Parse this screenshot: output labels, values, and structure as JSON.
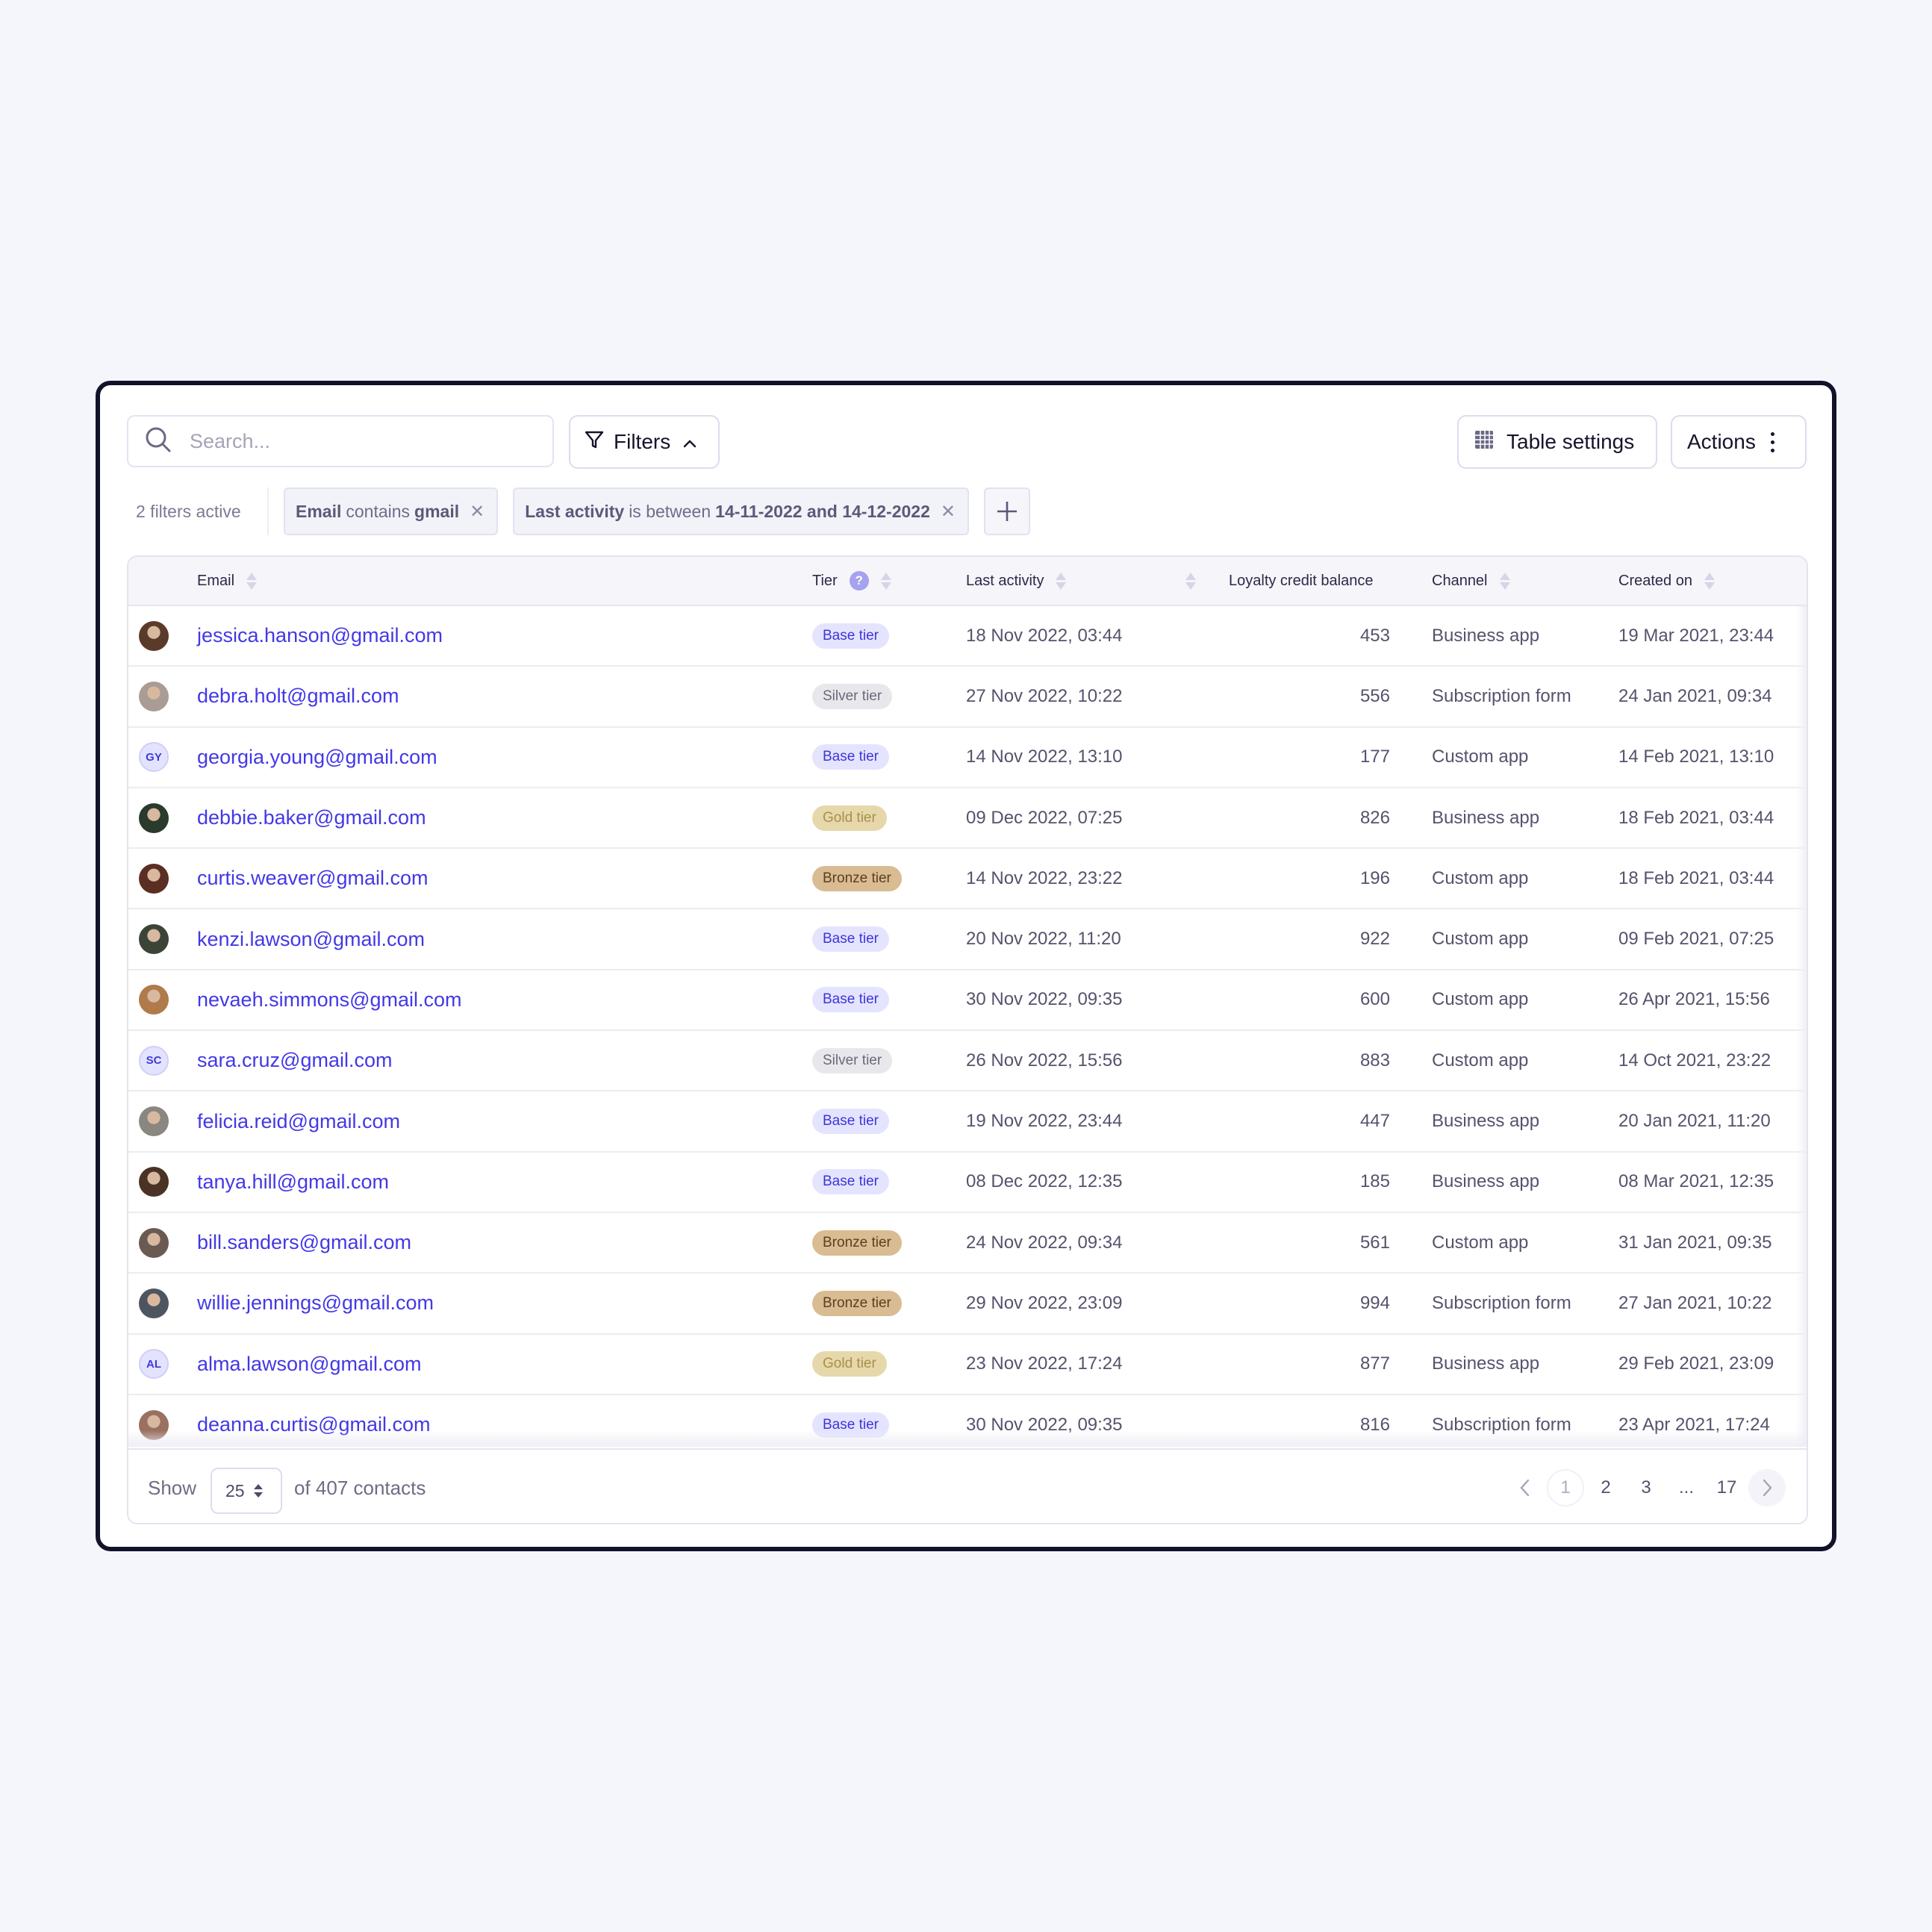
{
  "toolbar": {
    "search_placeholder": "Search...",
    "search_value": "",
    "filters_label": "Filters",
    "table_settings_label": "Table settings",
    "actions_label": "Actions"
  },
  "filters": {
    "active_count_label": "2 filters active",
    "chips": [
      {
        "field": "Email",
        "op": "contains",
        "value": "gmail"
      },
      {
        "field": "Last activity",
        "op": "is between",
        "value": "14-11-2022 and 14-12-2022"
      }
    ]
  },
  "table": {
    "columns": {
      "email": "Email",
      "tier": "Tier",
      "last_activity": "Last activity",
      "loyalty": "Loyalty credit balance",
      "channel": "Channel",
      "created_on": "Created on"
    },
    "tier_help_icon": "?",
    "rows": [
      {
        "avatar": {
          "type": "photo",
          "color": "#5a3b2a"
        },
        "email": "jessica.hanson@gmail.com",
        "tier": "Base tier",
        "tier_kind": "base",
        "last_activity": "18 Nov 2022, 03:44",
        "loyalty": "453",
        "channel": "Business app",
        "created_on": "19 Mar 2021, 23:44"
      },
      {
        "avatar": {
          "type": "photo",
          "color": "#a89c94"
        },
        "email": "debra.holt@gmail.com",
        "tier": "Silver tier",
        "tier_kind": "silver",
        "last_activity": "27 Nov 2022, 10:22",
        "loyalty": "556",
        "channel": "Subscription form",
        "created_on": "24 Jan 2021, 09:34"
      },
      {
        "avatar": {
          "type": "initials",
          "initials": "GY"
        },
        "email": "georgia.young@gmail.com",
        "tier": "Base tier",
        "tier_kind": "base",
        "last_activity": "14 Nov 2022, 13:10",
        "loyalty": "177",
        "channel": "Custom app",
        "created_on": "14 Feb 2021, 13:10"
      },
      {
        "avatar": {
          "type": "photo",
          "color": "#2a3a2c"
        },
        "email": "debbie.baker@gmail.com",
        "tier": "Gold tier",
        "tier_kind": "gold",
        "last_activity": "09 Dec 2022, 07:25",
        "loyalty": "826",
        "channel": "Business app",
        "created_on": "18 Feb 2021, 03:44"
      },
      {
        "avatar": {
          "type": "photo",
          "color": "#5a2e22"
        },
        "email": "curtis.weaver@gmail.com",
        "tier": "Bronze tier",
        "tier_kind": "bronze",
        "last_activity": "14 Nov 2022, 23:22",
        "loyalty": "196",
        "channel": "Custom app",
        "created_on": "18 Feb 2021, 03:44"
      },
      {
        "avatar": {
          "type": "photo",
          "color": "#3c4438"
        },
        "email": "kenzi.lawson@gmail.com",
        "tier": "Base tier",
        "tier_kind": "base",
        "last_activity": "20 Nov 2022, 11:20",
        "loyalty": "922",
        "channel": "Custom app",
        "created_on": "09 Feb 2021, 07:25"
      },
      {
        "avatar": {
          "type": "photo",
          "color": "#b07a4a"
        },
        "email": "nevaeh.simmons@gmail.com",
        "tier": "Base tier",
        "tier_kind": "base",
        "last_activity": "30 Nov 2022, 09:35",
        "loyalty": "600",
        "channel": "Custom app",
        "created_on": "26 Apr 2021, 15:56"
      },
      {
        "avatar": {
          "type": "initials",
          "initials": "SC"
        },
        "email": "sara.cruz@gmail.com",
        "tier": "Silver tier",
        "tier_kind": "silver",
        "last_activity": "26 Nov 2022, 15:56",
        "loyalty": "883",
        "channel": "Custom app",
        "created_on": "14 Oct 2021, 23:22"
      },
      {
        "avatar": {
          "type": "photo",
          "color": "#8a8680"
        },
        "email": "felicia.reid@gmail.com",
        "tier": "Base tier",
        "tier_kind": "base",
        "last_activity": "19 Nov 2022, 23:44",
        "loyalty": "447",
        "channel": "Business app",
        "created_on": "20 Jan 2021, 11:20"
      },
      {
        "avatar": {
          "type": "photo",
          "color": "#4a3224"
        },
        "email": "tanya.hill@gmail.com",
        "tier": "Base tier",
        "tier_kind": "base",
        "last_activity": "08 Dec 2022, 12:35",
        "loyalty": "185",
        "channel": "Business app",
        "created_on": "08 Mar 2021, 12:35"
      },
      {
        "avatar": {
          "type": "photo",
          "color": "#6b5a52"
        },
        "email": "bill.sanders@gmail.com",
        "tier": "Bronze tier",
        "tier_kind": "bronze",
        "last_activity": "24 Nov 2022, 09:34",
        "loyalty": "561",
        "channel": "Custom app",
        "created_on": "31 Jan 2021, 09:35"
      },
      {
        "avatar": {
          "type": "photo",
          "color": "#4c5560"
        },
        "email": "willie.jennings@gmail.com",
        "tier": "Bronze tier",
        "tier_kind": "bronze",
        "last_activity": "29 Nov 2022, 23:09",
        "loyalty": "994",
        "channel": "Subscription form",
        "created_on": "27 Jan 2021, 10:22"
      },
      {
        "avatar": {
          "type": "initials",
          "initials": "AL"
        },
        "email": "alma.lawson@gmail.com",
        "tier": "Gold tier",
        "tier_kind": "gold",
        "last_activity": "23 Nov 2022, 17:24",
        "loyalty": "877",
        "channel": "Business app",
        "created_on": "29 Feb 2021, 23:09"
      },
      {
        "avatar": {
          "type": "photo",
          "color": "#9a7060"
        },
        "email": "deanna.curtis@gmail.com",
        "tier": "Base tier",
        "tier_kind": "base",
        "last_activity": "30 Nov 2022, 09:35",
        "loyalty": "816",
        "channel": "Subscription form",
        "created_on": "23 Apr 2021, 17:24"
      }
    ]
  },
  "footer": {
    "show_label": "Show",
    "page_size": "25",
    "total_label": "of 407 contacts",
    "pages": [
      "1",
      "2",
      "3",
      "...",
      "17"
    ],
    "current_page": "1"
  },
  "colors": {
    "accent": "#4338e6",
    "frame_border": "#13122b",
    "background": "#f5f6fc"
  }
}
